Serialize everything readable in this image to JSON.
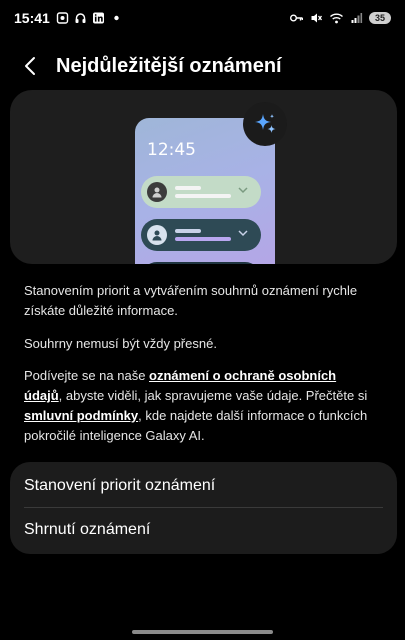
{
  "status_bar": {
    "time": "15:41",
    "battery": "35"
  },
  "header": {
    "title": "Nejdůležitější oznámení"
  },
  "hero": {
    "phone_time": "12:45"
  },
  "description": {
    "p1": "Stanovením priorit a vytvářením souhrnů oznámení rychle získáte důležité informace.",
    "p2": "Souhrny nemusí být vždy přesné.",
    "p3_part1": "Podívejte se na naše ",
    "p3_link1": "oznámení o ochraně osobních údajů",
    "p3_part2": ", abyste viděli, jak spravujeme vaše údaje. Přečtěte si ",
    "p3_link2": "smluvní podmínky",
    "p3_part3": ", kde najdete další informace o funkcích pokročilé inteligence Galaxy AI."
  },
  "settings": {
    "items": [
      {
        "label": "Stanovení priorit oznámení"
      },
      {
        "label": "Shrnutí oznámení"
      }
    ]
  }
}
